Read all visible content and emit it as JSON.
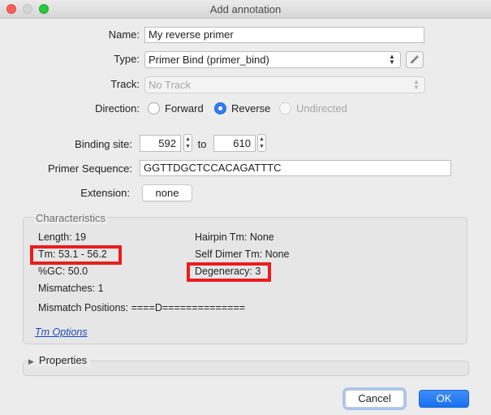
{
  "window": {
    "title": "Add annotation"
  },
  "form": {
    "name_label": "Name:",
    "name_value": "My reverse primer",
    "type_label": "Type:",
    "type_value": "Primer Bind (primer_bind)",
    "track_label": "Track:",
    "track_value": "No Track",
    "direction_label": "Direction:",
    "directions": [
      {
        "label": "Forward",
        "selected": false,
        "enabled": true
      },
      {
        "label": "Reverse",
        "selected": true,
        "enabled": true
      },
      {
        "label": "Undirected",
        "selected": false,
        "enabled": false
      }
    ],
    "binding_label": "Binding site:",
    "binding_from": "592",
    "binding_to_label": "to",
    "binding_to": "610",
    "primer_seq_label": "Primer Sequence:",
    "primer_seq_value": "GGTTDGCTCCACAGATTTC",
    "extension_label": "Extension:",
    "extension_value": "none"
  },
  "characteristics": {
    "title": "Characteristics",
    "length": "Length: 19",
    "tm": "Tm: 53.1 - 56.2",
    "gc": "%GC: 50.0",
    "mismatches": "Mismatches: 1",
    "hairpin_tm": "Hairpin Tm: None",
    "self_dimer_tm": "Self Dimer Tm: None",
    "degeneracy": "Degeneracy: 3",
    "mismatch_positions": "Mismatch Positions: ====D==============",
    "tm_options": "Tm Options"
  },
  "properties": {
    "title": "Properties"
  },
  "buttons": {
    "cancel": "Cancel",
    "ok": "OK"
  },
  "colors": {
    "highlight": "#ec1c1c",
    "accent": "#1a70f0",
    "link": "#1946ba"
  }
}
